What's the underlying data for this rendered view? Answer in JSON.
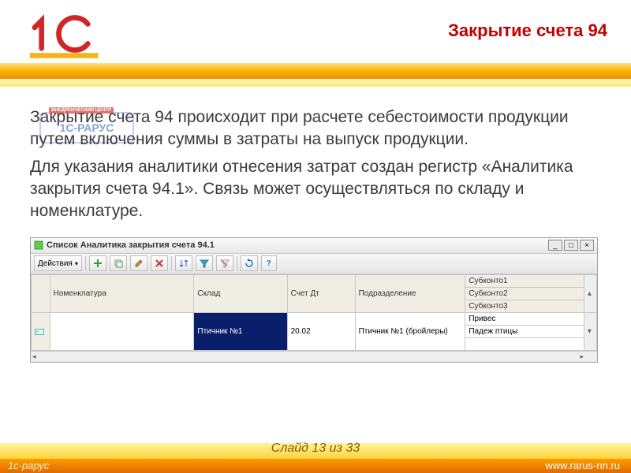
{
  "header": {
    "title": "Закрытие счета 94",
    "watermark_label": "1С-РАРУС",
    "watermark_badge": "ВНЕДРЕНЧЕСКИЙ ЦЕНТР"
  },
  "body": {
    "para1": "Закрытие счета 94 происходит при расчете себестоимости продукции путем включения суммы в затраты на выпуск продукции.",
    "para2": "Для указания аналитики отнесения затрат создан регистр «Аналитика закрытия счета 94.1». Связь может осуществляться по складу и номенклатуре."
  },
  "window": {
    "title": "Список Аналитика закрытия счета 94.1",
    "actions_label": "Действия",
    "toolbar_icons": [
      "add",
      "add-copy",
      "edit",
      "delete",
      "sort",
      "filter",
      "filter-clear",
      "refresh",
      "help"
    ],
    "columns": {
      "nomen": "Номенклатура",
      "sklad": "Склад",
      "schet": "Счет Дт",
      "podr": "Подразделение",
      "sub1": "Субконто1",
      "sub2": "Субконто2",
      "sub3": "Субконто3"
    },
    "row": {
      "sklad": "Птичник №1",
      "schet": "20.02",
      "podr": "Птичник №1 (бройлеры)",
      "sub1": "Привес",
      "sub2": "Падеж птицы"
    }
  },
  "footer": {
    "slide_counter": "Слайд 13 из 33",
    "brand_left": "1с-рарус",
    "brand_right": "www.rarus-nn.ru"
  },
  "colors": {
    "accent_red": "#c00000",
    "selection_blue": "#0a1f6b",
    "orange": "#ff9a00"
  }
}
